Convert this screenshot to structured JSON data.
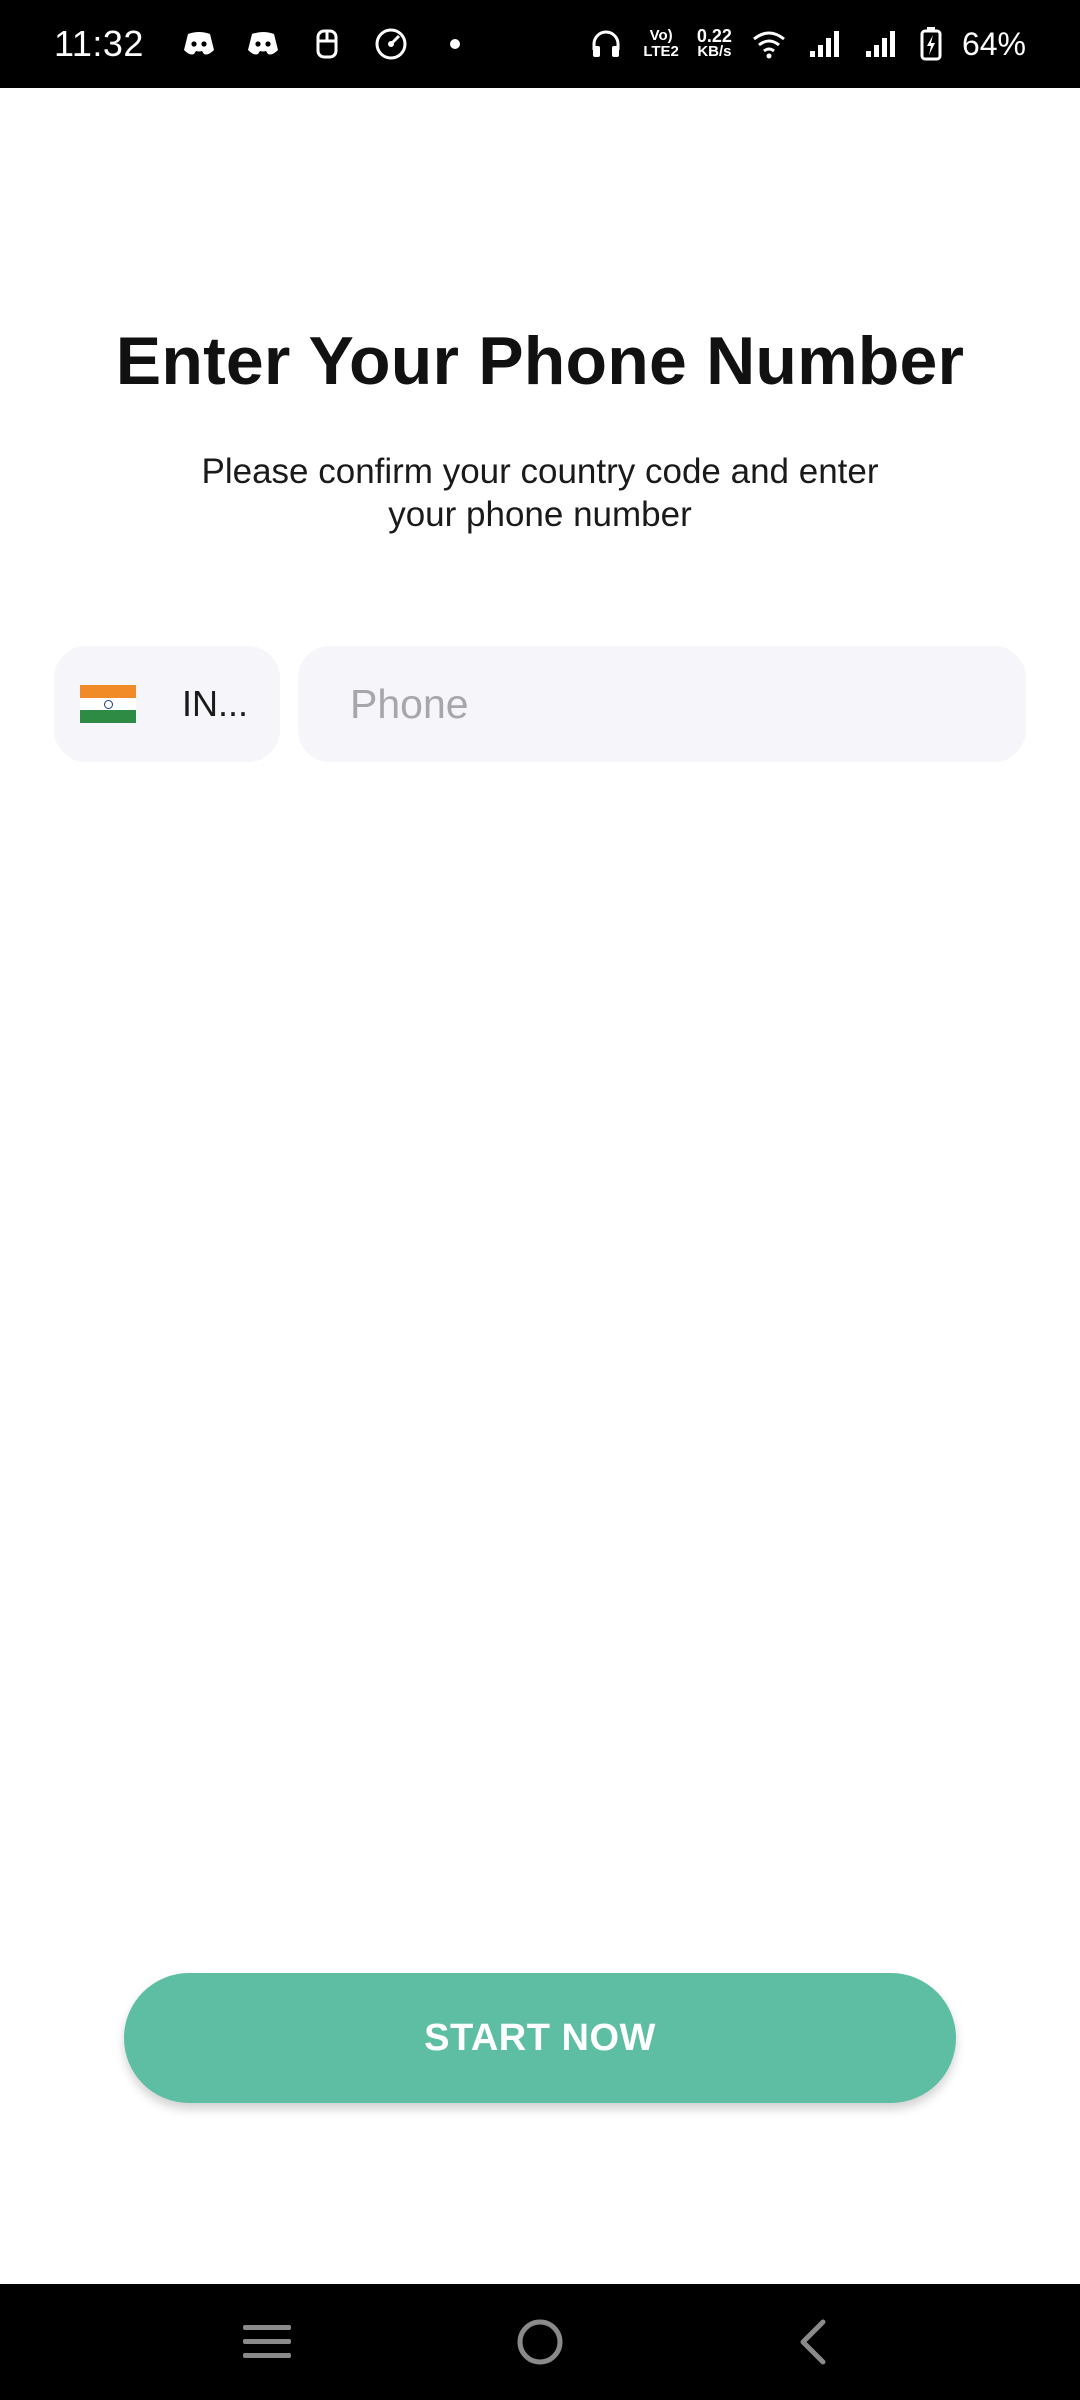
{
  "status_bar": {
    "time": "11:32",
    "notification_icons": [
      "discord-icon",
      "discord-icon",
      "gamepad-icon",
      "speedometer-icon",
      "dot-icon"
    ],
    "network_top": "Vo)",
    "network_bottom": "LTE2",
    "speed_value": "0.22",
    "speed_unit": "KB/s",
    "battery_percent": "64%"
  },
  "main": {
    "title": "Enter Your Phone Number",
    "subtitle": "Please confirm your country code and enter your phone number",
    "country_picker": {
      "flag": "india-flag-icon",
      "code_label": "IN..."
    },
    "phone_input": {
      "value": "",
      "placeholder": "Phone"
    },
    "start_button_label": "START NOW"
  },
  "colors": {
    "accent": "#5ebea3",
    "field_background": "#f6f6fa",
    "placeholder": "#a6a6ab"
  },
  "nav_bar": {
    "items": [
      "menu-icon",
      "home-icon",
      "back-icon"
    ]
  }
}
